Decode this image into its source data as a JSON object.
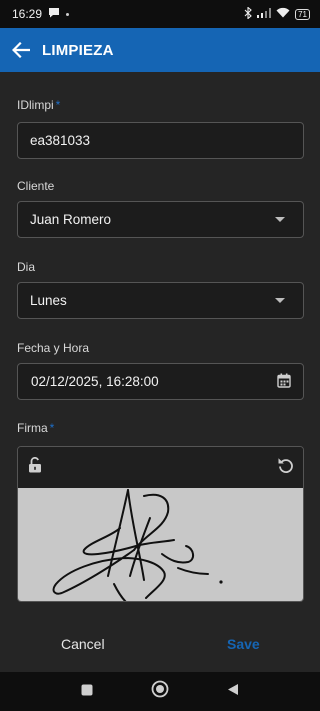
{
  "status_bar": {
    "time": "16:29",
    "battery": "71"
  },
  "app_bar": {
    "title": "LIMPIEZA"
  },
  "form": {
    "idlimpi": {
      "label": "IDlimpi",
      "required_mark": "*",
      "value": "ea381033"
    },
    "cliente": {
      "label": "Cliente",
      "value": "Juan Romero"
    },
    "dia": {
      "label": "Dia",
      "value": "Lunes"
    },
    "fecha_hora": {
      "label": "Fecha y Hora",
      "value": "02/12/2025, 16:28:00"
    },
    "firma": {
      "label": "Firma",
      "required_mark": "*"
    }
  },
  "actions": {
    "cancel": "Cancel",
    "save": "Save"
  },
  "colors": {
    "accent": "#1565b4",
    "background": "#252525",
    "signature_area": "#c8c8c8"
  },
  "icons": [
    "chat-icon",
    "bluetooth-icon",
    "signal-icon",
    "wifi-icon",
    "battery-icon",
    "arrow-back-icon",
    "chevron-down-icon",
    "calendar-icon",
    "unlock-icon",
    "undo-icon",
    "nav-square-icon",
    "nav-circle-icon",
    "nav-triangle-icon"
  ]
}
